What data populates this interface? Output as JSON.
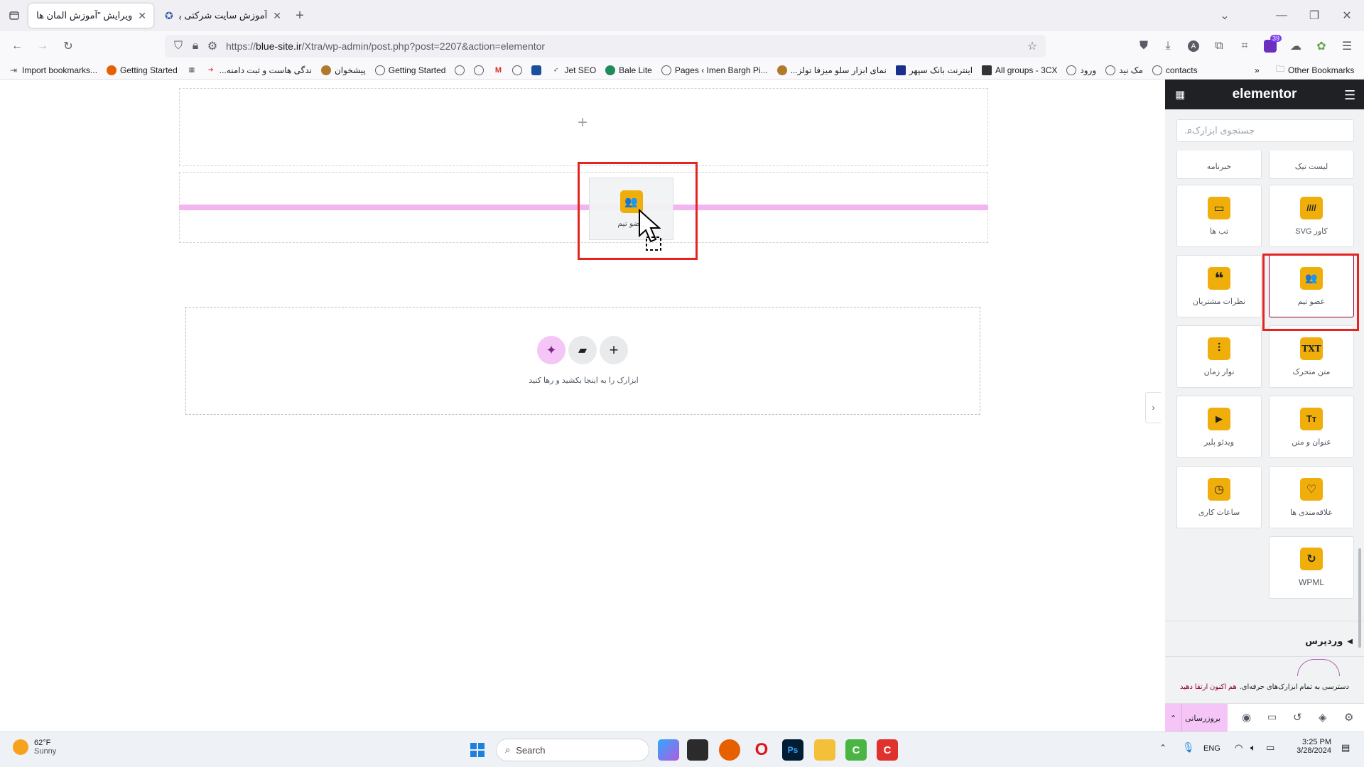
{
  "browser": {
    "tabs": [
      {
        "title": "ویرایش \"آموزش المان های اکسترا – ...\"",
        "active": true
      },
      {
        "title": "آموزش سایت شرکتی با قالب اکس...",
        "active": false
      }
    ],
    "new_tab_label": "+",
    "url_prefix": "https://",
    "url_host": "blue-site.ir",
    "url_path": "/Xtra/wp-admin/post.php?post=2207&action=elementor",
    "downloads_badge": "39",
    "bookmarks": [
      {
        "label": "Import bookmarks...",
        "icon": "import-icon",
        "color": "#5b5b66"
      },
      {
        "label": "Getting Started",
        "icon": "firefox-icon",
        "color": "#e66000"
      },
      {
        "label": "",
        "icon": "calendar-icon",
        "color": "#5b5b66"
      },
      {
        "label": "...ندگی هاست و ثبت دامنه",
        "icon": "arrow-icon",
        "color": "#d04040"
      },
      {
        "label": "پیشخوان",
        "icon": "lion-icon",
        "color": "#b07a2a"
      },
      {
        "label": "Getting Started",
        "icon": "globe-icon",
        "color": "#5b5b66"
      },
      {
        "label": "",
        "icon": "globe-icon",
        "color": "#5b5b66"
      },
      {
        "label": "",
        "icon": "globe-icon",
        "color": "#5b5b66"
      },
      {
        "label": "",
        "icon": "gmail-icon",
        "color": "#d93025"
      },
      {
        "label": "",
        "icon": "globe-icon",
        "color": "#5b5b66"
      },
      {
        "label": "",
        "icon": "square-icon",
        "color": "#1a4f9c"
      },
      {
        "label": "Jet SEO",
        "icon": "rocket-icon",
        "color": "#5b5b66"
      },
      {
        "label": "Bale Lite",
        "icon": "bale-icon",
        "color": "#1f8a5b"
      },
      {
        "label": "Pages ‹ Imen Bargh Pi...",
        "icon": "globe-icon",
        "color": "#5b5b66"
      },
      {
        "label": "...نمای ابزار سلو میزفا تولز",
        "icon": "lion-icon",
        "color": "#b07a2a"
      },
      {
        "label": "اینترنت بانک سپهر",
        "icon": "bank-icon",
        "color": "#1a2f8c"
      },
      {
        "label": "All groups - 3CX",
        "icon": "3cx-icon",
        "color": "#333"
      },
      {
        "label": "ورود",
        "icon": "globe-icon",
        "color": "#5b5b66"
      },
      {
        "label": "مک نید",
        "icon": "globe-icon",
        "color": "#5b5b66"
      },
      {
        "label": "contacts",
        "icon": "globe-icon",
        "color": "#5b5b66"
      }
    ],
    "other_bookmarks": "Other Bookmarks"
  },
  "canvas": {
    "add_section_plus": "+",
    "drop_hint": "ابزارک را به اینجا بکشید و رها کنید",
    "dragged_widget_label": "عضو تیم",
    "drop_indicator_color": "#f3b5f0"
  },
  "panel": {
    "brand": "elementor",
    "search_placeholder": "جستجوی ابزارک...",
    "widgets": [
      {
        "label": "لیست تیک",
        "icon": "list-icon",
        "glyph": "☰"
      },
      {
        "label": "خبرنامه",
        "icon": "newsletter-icon",
        "glyph": "✉"
      },
      {
        "label": "کاور SVG",
        "icon": "svg-cover-icon",
        "glyph": "////"
      },
      {
        "label": "تب ها",
        "icon": "tabs-icon",
        "glyph": "▭"
      },
      {
        "label": "عضو تیم",
        "icon": "team-member-icon",
        "glyph": "👥"
      },
      {
        "label": "نظرات مشتریان",
        "icon": "testimonials-icon",
        "glyph": "❝"
      },
      {
        "label": "متن متحرک",
        "icon": "animated-text-icon",
        "glyph": "TXT"
      },
      {
        "label": "نوار زمان",
        "icon": "timeline-icon",
        "glyph": "≡"
      },
      {
        "label": "عنوان و متن",
        "icon": "heading-text-icon",
        "glyph": "TT"
      },
      {
        "label": "ویدئو پلیر",
        "icon": "video-player-icon",
        "glyph": "▶"
      },
      {
        "label": "علاقه‌مندی ها",
        "icon": "wishlist-icon",
        "glyph": "♡"
      },
      {
        "label": "ساعات کاری",
        "icon": "clock-icon",
        "glyph": "◷"
      },
      {
        "label": "WPML",
        "icon": "wpml-icon",
        "glyph": "↻"
      }
    ],
    "category_label": "وردپرس",
    "promo_text": "دسترسی به تمام ابزارک‌های حرفه‌ای.",
    "promo_link": "هم اکنون ارتقا دهید",
    "update_button": "بروزرسانی"
  },
  "taskbar": {
    "weather_temp": "62°F",
    "weather_desc": "Sunny",
    "search_placeholder": "Search",
    "language": "ENG",
    "time": "3:25 PM",
    "date": "3/28/2024"
  }
}
